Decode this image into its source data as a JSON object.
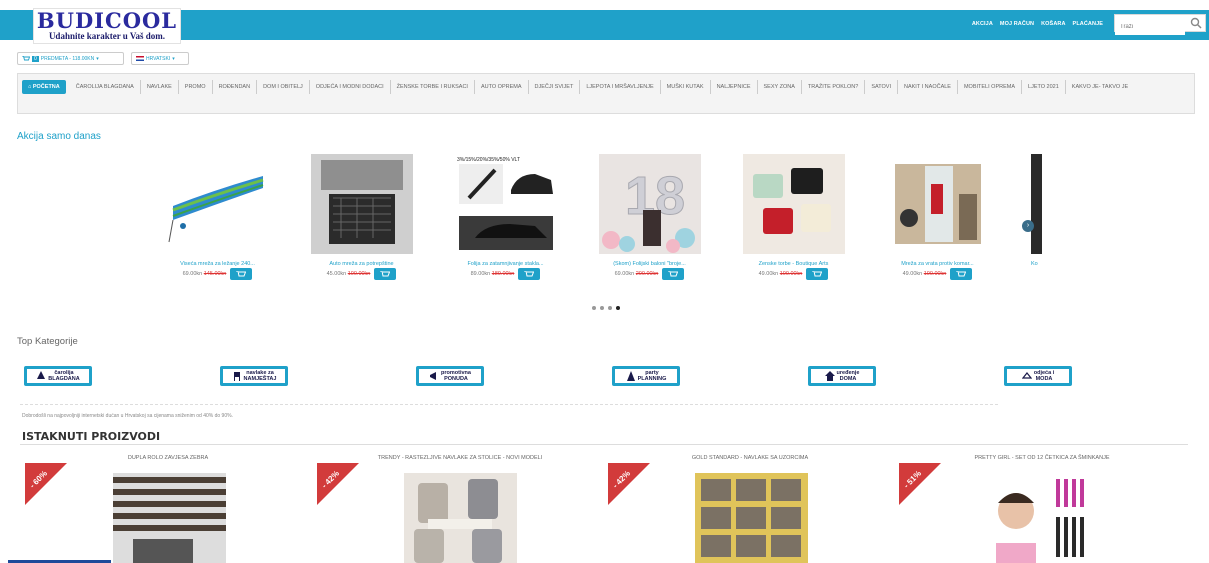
{
  "brand": {
    "name": "BUDICOOL",
    "tagline": "Udahnite karakter u Vaš dom."
  },
  "topnav": [
    "AKCIJA",
    "MOJ RAČUN",
    "KOŠARA",
    "PLAĆANJE"
  ],
  "search": {
    "placeholder": "Traži"
  },
  "cart": {
    "count": "0",
    "label": "PREDMETA - 118.00KN"
  },
  "language": {
    "label": "HRVATSKI"
  },
  "menu": [
    "POČETNA",
    "ČAROLIJA BLAGDANA",
    "NAVLAKE",
    "PROMO",
    "ROĐENDAN",
    "DOM I OBITELJ",
    "ODJEĆA I MODNI DODACI",
    "ŽENSKE TORBE I RUKSACI",
    "AUTO OPREMA",
    "DJEČJI SVIJET",
    "LJEPOTA I MRŠAVLJENJE",
    "MUŠKI KUTAK",
    "NALJEPNICE",
    "SEXY ZONA",
    "TRAŽITE POKLON?",
    "SATOVI",
    "NAKIT I NAOČALE",
    "MOBITELI OPREMA",
    "LJETO 2021",
    "KAKVO JE- TAKVO JE"
  ],
  "deals_title": "Akcija samo danas",
  "deals": [
    {
      "title": "Viseća mreža za ležanje 240...",
      "price": "69.00kn",
      "old": "145.00kn"
    },
    {
      "title": "Auto mreža za potrepštine",
      "price": "45.00kn",
      "old": "100.00kn"
    },
    {
      "title": "Folija za zatamnjivanje stakla...",
      "price": "89.00kn",
      "old": "189.00kn"
    },
    {
      "title": "(Škom) Folijski baloni \"broje...",
      "price": "69.00kn",
      "old": "200.00kn"
    },
    {
      "title": "Ženske torbe - Boutique Arts",
      "price": "49.00kn",
      "old": "100.00kn"
    },
    {
      "title": "Mreža za vrata protiv komar...",
      "price": "49.00kn",
      "old": "100.00kn"
    },
    {
      "title": "Ko"
    }
  ],
  "overlay_text": "3%/15%/20%/35%/50% VLT",
  "top_cat_title": "Top Kategorije",
  "categories": [
    {
      "l1": "čarolija",
      "l2": "BLAGDANA"
    },
    {
      "l1": "navlake za",
      "l2": "NAMJEŠTAJ"
    },
    {
      "l1": "promotivna",
      "l2": "PONUDA"
    },
    {
      "l1": "party",
      "l2": "PLANNING"
    },
    {
      "l1": "uređenje",
      "l2": "DOMA"
    },
    {
      "l1": "odjeća i",
      "l2": "MODA"
    }
  ],
  "welcome": "Dobrodošli na najpovoljniji internetski dućan u Hrvatskoj sa cijenama sniženim od 40% do 90%.",
  "featured_title": "ISTAKNUTI PROIZVODI",
  "featured": [
    {
      "title": "DUPLA ROLO ZAVJESA ZEBRA",
      "discount": "- 60%"
    },
    {
      "title": "TRENDY - RASTEZLJIVE NAVLAKE ZA STOLICE - NOVI MODELI",
      "discount": "- 42%"
    },
    {
      "title": "GOLD STANDARD - NAVLAKE SA UZORCIMA",
      "discount": "- 42%"
    },
    {
      "title": "PRETTY GIRL - SET OD 12 ČETKICA ZA ŠMINKANJE",
      "discount": "- 51%"
    }
  ],
  "colors": {
    "accent": "#1fa1c9",
    "sale": "#d23b3b",
    "old_price": "#dd3333"
  }
}
